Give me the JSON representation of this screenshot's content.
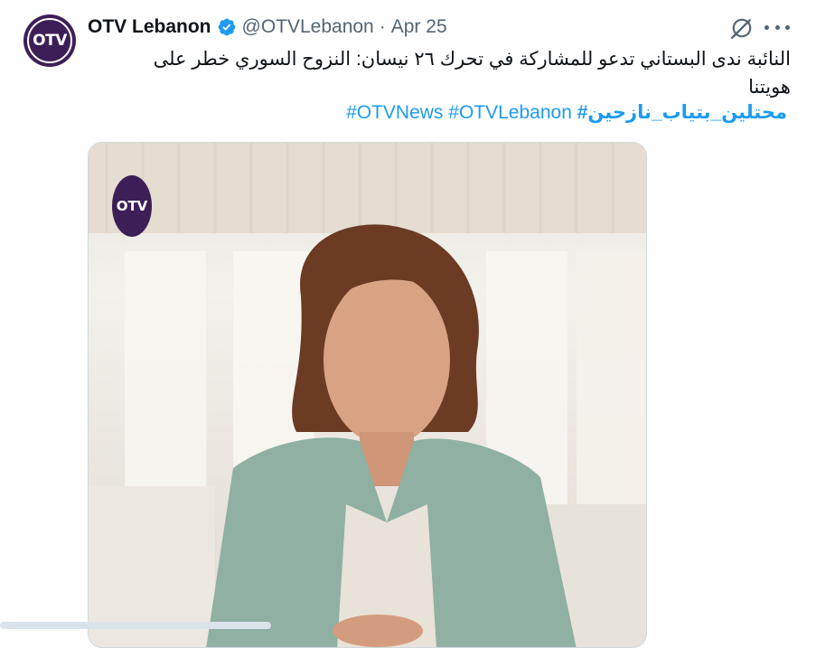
{
  "account": {
    "name": "OTV Lebanon",
    "handle": "@OTVLebanon",
    "separator": "·",
    "date": "Apr 25",
    "avatar_text": "OTV"
  },
  "tweet": {
    "text": "النائبة ندى البستاني تدعو للمشاركة في تحرك ٢٦ نيسان: النزوح السوري خطر على هويتنا",
    "hashtags": [
      "#OTVNews",
      "#OTVLebanon",
      "#محتلين_بتياب_نازحين"
    ]
  },
  "media": {
    "watermark_text": "OTV"
  },
  "icons": {
    "verified": "verified-badge-icon",
    "grok": "grok-icon",
    "more": "more-options-icon"
  },
  "colors": {
    "link": "#1d9bf0",
    "verified": "#1d9bf0",
    "brand": "#3d1f57",
    "secondary_text": "#536471"
  }
}
